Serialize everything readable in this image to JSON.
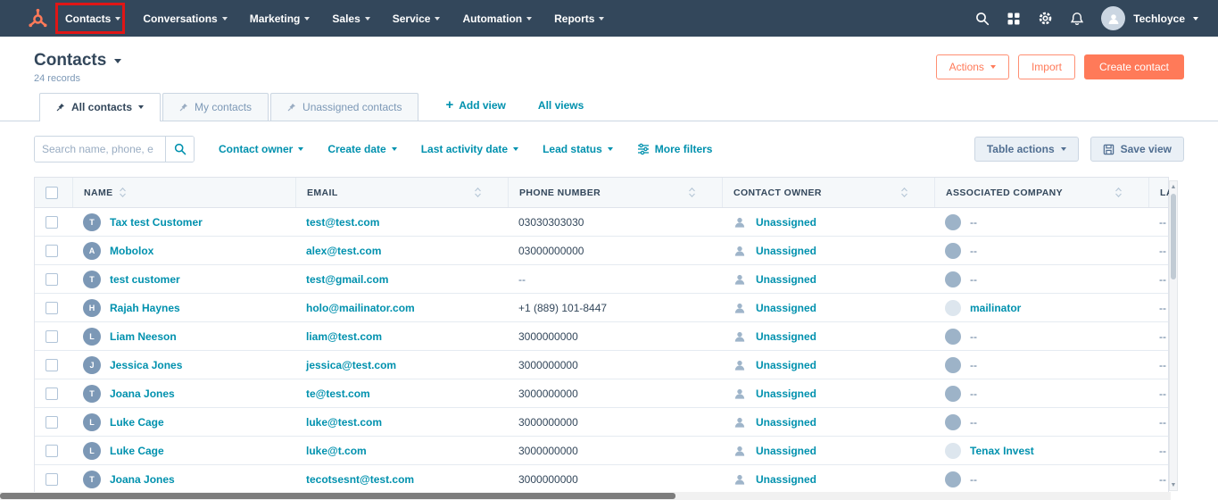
{
  "navbar": {
    "items": [
      {
        "label": "Contacts"
      },
      {
        "label": "Conversations"
      },
      {
        "label": "Marketing"
      },
      {
        "label": "Sales"
      },
      {
        "label": "Service"
      },
      {
        "label": "Automation"
      },
      {
        "label": "Reports"
      }
    ],
    "account_name": "Techloyce"
  },
  "header": {
    "title": "Contacts",
    "record_count": "24 records",
    "actions_button": "Actions",
    "import_button": "Import",
    "create_button": "Create contact"
  },
  "views": {
    "tabs": [
      {
        "label": "All contacts"
      },
      {
        "label": "My contacts"
      },
      {
        "label": "Unassigned contacts"
      }
    ],
    "add_view": "Add view",
    "all_views": "All views"
  },
  "filters": {
    "search_placeholder": "Search name, phone, e",
    "dropdowns": [
      {
        "label": "Contact owner"
      },
      {
        "label": "Create date"
      },
      {
        "label": "Last activity date"
      },
      {
        "label": "Lead status"
      }
    ],
    "more_filters": "More filters",
    "table_actions_button": "Table actions",
    "save_view_button": "Save view"
  },
  "table": {
    "columns": [
      "NAME",
      "EMAIL",
      "PHONE NUMBER",
      "CONTACT OWNER",
      "ASSOCIATED COMPANY",
      "LA"
    ],
    "rows": [
      {
        "initial": "T",
        "name": "Tax test Customer",
        "email": "test@test.com",
        "phone": "03030303030",
        "owner": "Unassigned",
        "company": "--",
        "last": "--"
      },
      {
        "initial": "A",
        "name": "Mobolox",
        "email": "alex@test.com",
        "phone": "03000000000",
        "owner": "Unassigned",
        "company": "--",
        "last": "--"
      },
      {
        "initial": "T",
        "name": "test customer",
        "email": "test@gmail.com",
        "phone": "--",
        "owner": "Unassigned",
        "company": "--",
        "last": "--"
      },
      {
        "initial": "H",
        "name": "Rajah Haynes",
        "email": "holo@mailinator.com",
        "phone": "+1 (889) 101-8447",
        "owner": "Unassigned",
        "company": "mailinator",
        "last": "--"
      },
      {
        "initial": "L",
        "name": "Liam Neeson",
        "email": "liam@test.com",
        "phone": "3000000000",
        "owner": "Unassigned",
        "company": "--",
        "last": "--"
      },
      {
        "initial": "J",
        "name": "Jessica Jones",
        "email": "jessica@test.com",
        "phone": "3000000000",
        "owner": "Unassigned",
        "company": "--",
        "last": "--"
      },
      {
        "initial": "T",
        "name": "Joana Jones",
        "email": "te@test.com",
        "phone": "3000000000",
        "owner": "Unassigned",
        "company": "--",
        "last": "--"
      },
      {
        "initial": "L",
        "name": "Luke Cage",
        "email": "luke@test.com",
        "phone": "3000000000",
        "owner": "Unassigned",
        "company": "--",
        "last": "--"
      },
      {
        "initial": "L",
        "name": "Luke Cage",
        "email": "luke@t.com",
        "phone": "3000000000",
        "owner": "Unassigned",
        "company": "Tenax Invest",
        "last": "--"
      },
      {
        "initial": "T",
        "name": "Joana Jones",
        "email": "tecotsesnt@test.com",
        "phone": "3000000000",
        "owner": "Unassigned",
        "company": "--",
        "last": "--"
      }
    ]
  },
  "colors": {
    "navbar_bg": "#33475b",
    "brand_orange": "#ff7a59",
    "link_teal": "#0091ae",
    "annotation_red": "#e01616"
  }
}
